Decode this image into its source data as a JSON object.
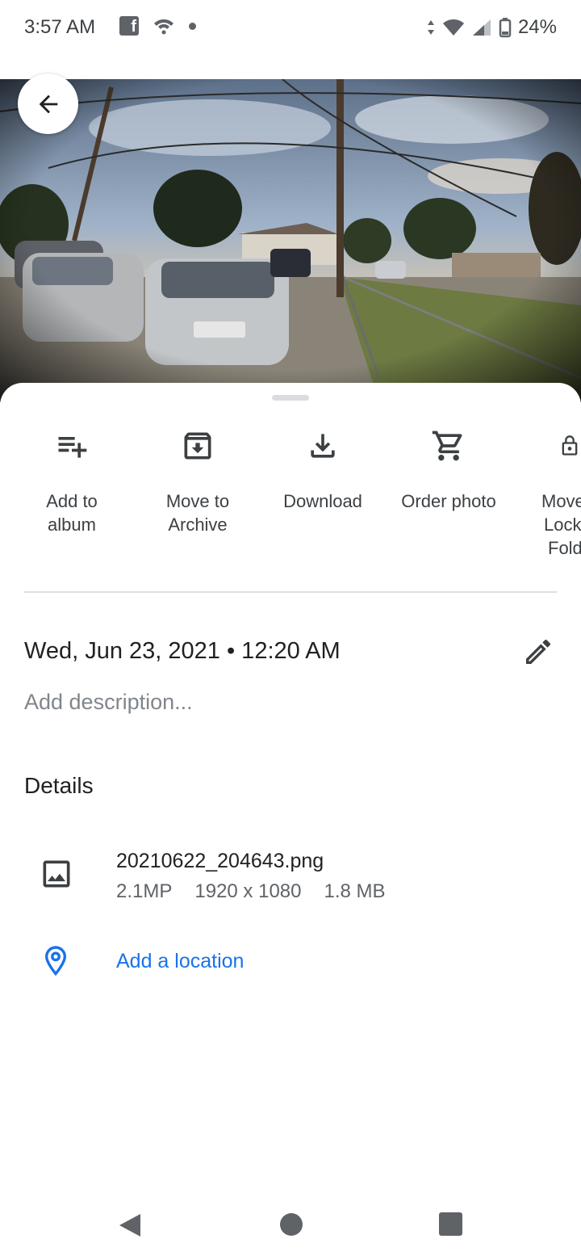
{
  "status_bar": {
    "time": "3:57 AM",
    "battery": "24%"
  },
  "actions": [
    {
      "label_line1": "Add to",
      "label_line2": "album",
      "icon": "playlist-add-icon"
    },
    {
      "label_line1": "Move to",
      "label_line2": "Archive",
      "icon": "archive-icon"
    },
    {
      "label_line1": "Download",
      "label_line2": "",
      "icon": "download-icon"
    },
    {
      "label_line1": "Order photo",
      "label_line2": "",
      "icon": "cart-icon"
    },
    {
      "label_line1": "Move",
      "label_line2": "Lock",
      "label_line3": "Fold",
      "icon": "lock-icon"
    }
  ],
  "info": {
    "datetime": "Wed, Jun 23, 2021 • 12:20 AM",
    "description_placeholder": "Add description..."
  },
  "details": {
    "title": "Details",
    "file_name": "20210622_204643.png",
    "megapixels": "2.1MP",
    "resolution": "1920 x 1080",
    "size": "1.8 MB",
    "location_link": "Add a location"
  },
  "colors": {
    "accent": "#1a73e8",
    "icon": "#3c4043"
  }
}
